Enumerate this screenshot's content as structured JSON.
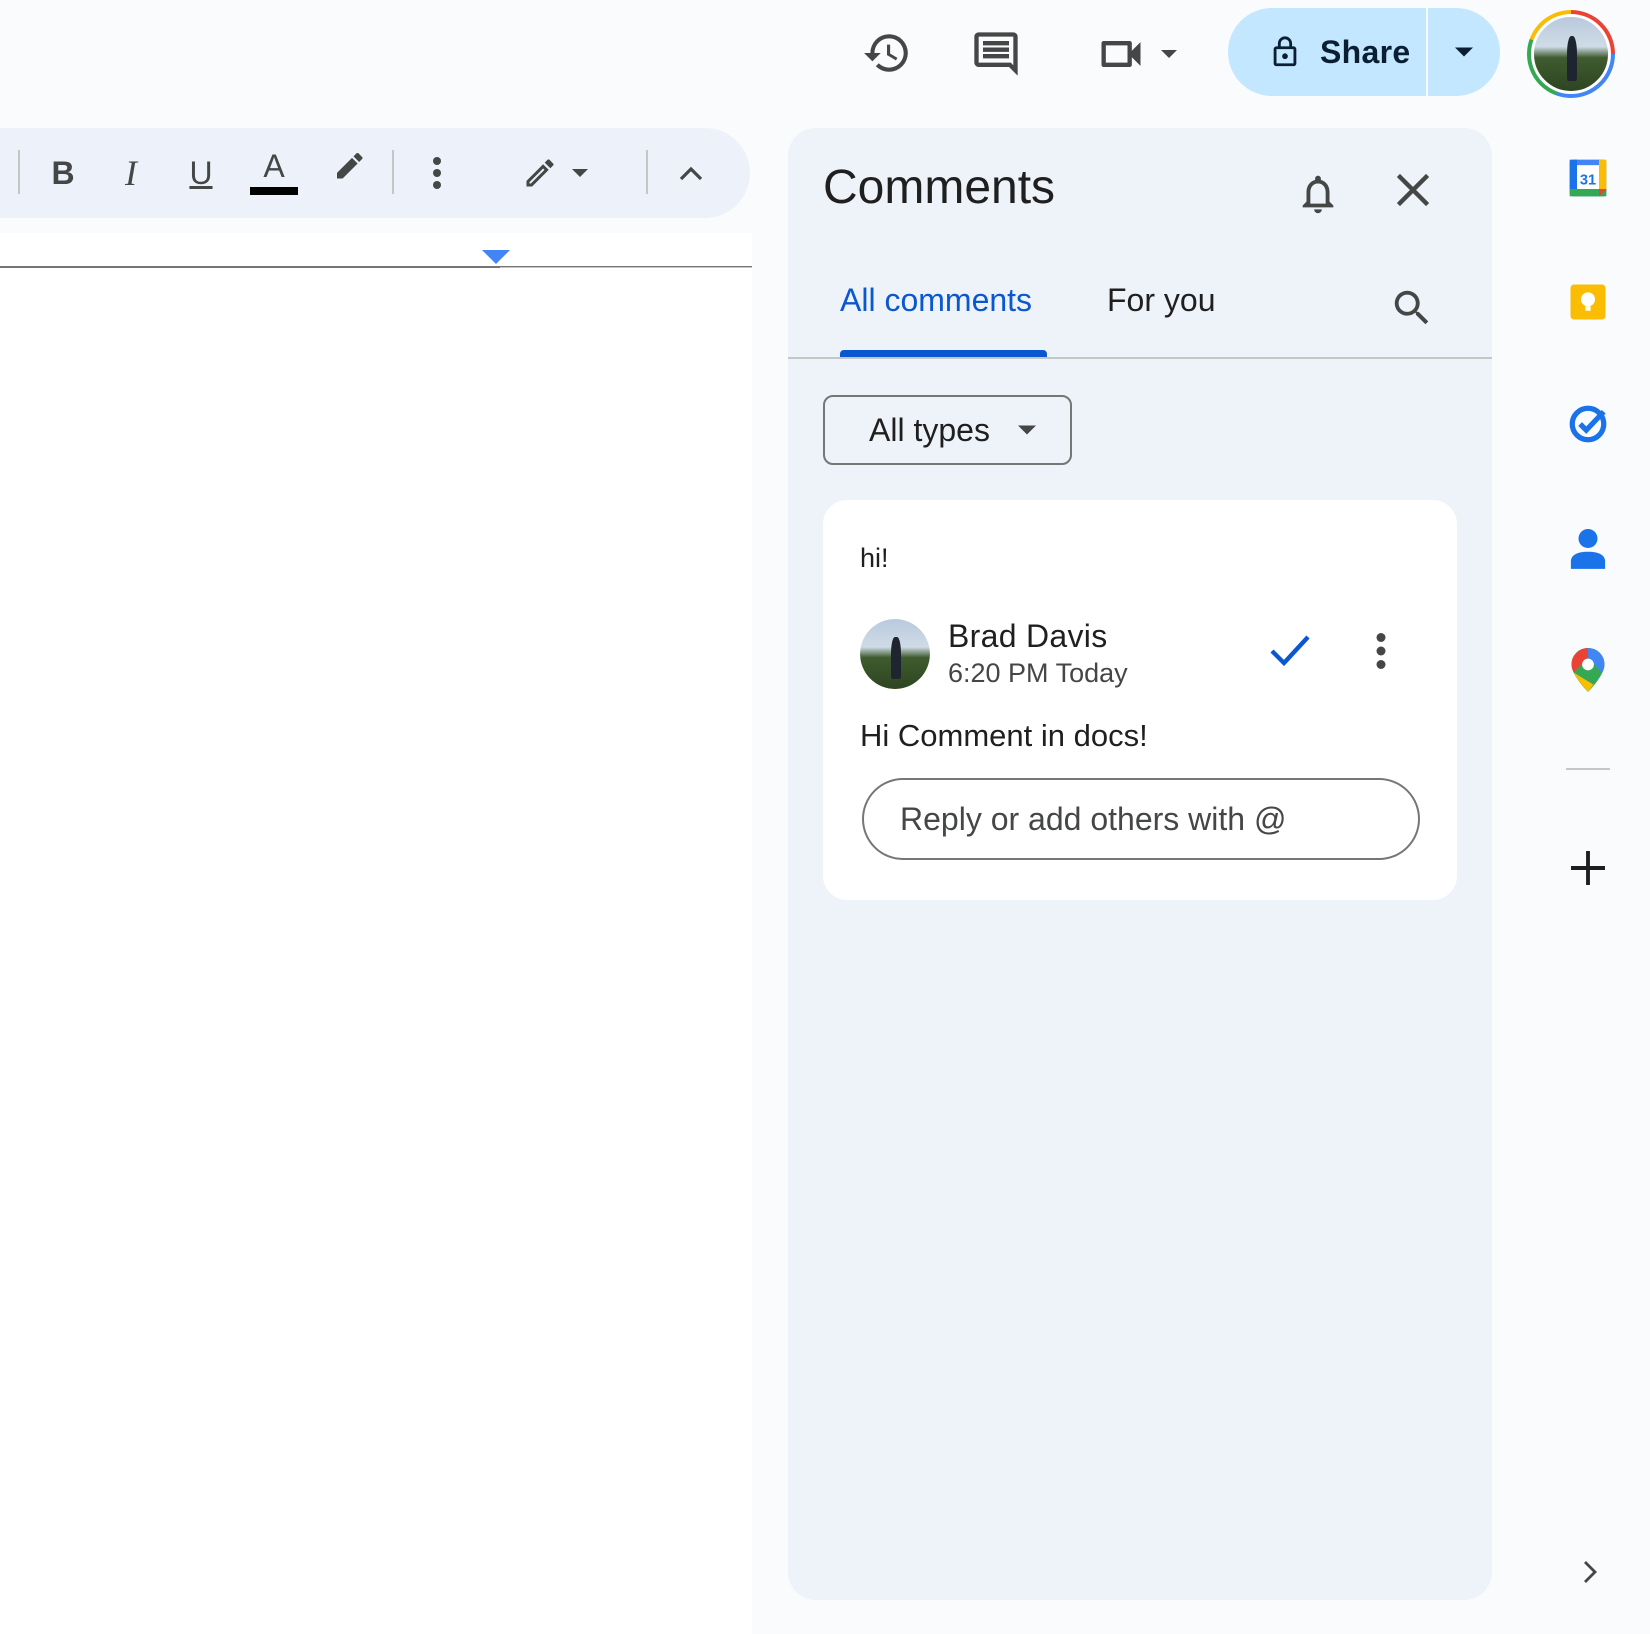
{
  "header": {
    "share_label": "Share",
    "icons": [
      "history-icon",
      "comment-icon",
      "video-icon",
      "lock-icon",
      "caret-down-icon",
      "avatar"
    ]
  },
  "toolbar": {
    "bold_label": "B",
    "italic_label": "I",
    "underline_label": "U",
    "text_color_label": "A",
    "icons": [
      "bold-icon",
      "italic-icon",
      "underline-icon",
      "text-color-icon",
      "highlight-icon",
      "more-icon",
      "editing-mode-icon",
      "collapse-icon"
    ]
  },
  "comments_panel": {
    "title": "Comments",
    "tabs": [
      {
        "label": "All comments",
        "active": true
      },
      {
        "label": "For you",
        "active": false
      }
    ],
    "filter": {
      "selected": "All types"
    },
    "threads": [
      {
        "quoted_text": "hi!",
        "author": "Brad Davis",
        "time": "6:20 PM Today",
        "body": "Hi Comment in docs!",
        "reply_placeholder": "Reply or add others with @"
      }
    ]
  },
  "side_panel": {
    "apps": [
      "calendar-icon",
      "keep-icon",
      "tasks-icon",
      "contacts-icon",
      "maps-icon"
    ],
    "calendar_day": "31"
  },
  "colors": {
    "accent": "#0b57d0",
    "share_bg": "#c2e7ff",
    "panel_bg": "#eef2f9",
    "page_bg": "#f9fbfd"
  }
}
